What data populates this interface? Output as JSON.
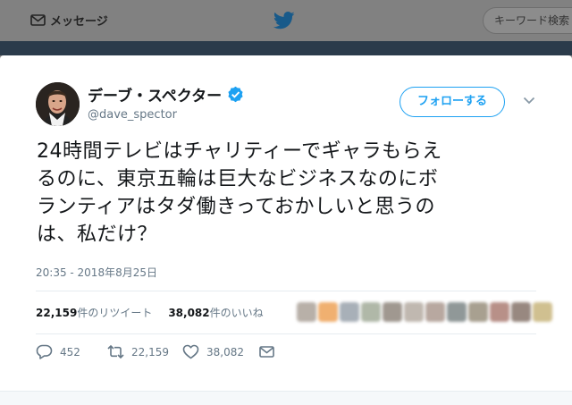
{
  "nav": {
    "messages_label": "メッセージ",
    "search_placeholder": "キーワード検索"
  },
  "tweet": {
    "display_name": "デーブ・スペクター",
    "handle": "@dave_spector",
    "follow_label": "フォローする",
    "text_lines": [
      "24時間テレビはチャリティーでギャラもらえ",
      "るのに、東京五輪は巨大なビジネスなのにボ",
      "ランティアはタダ働きっておかしいと思うの",
      "は、私だけ？"
    ],
    "timestamp": "20:35 - 2018年8月25日",
    "retweet_count": "22,159",
    "retweet_label": "件のリツイート",
    "like_count": "38,082",
    "like_label": "件のいいね",
    "actions": {
      "reply_count": "452",
      "retweet_count": "22,159",
      "like_count": "38,082"
    }
  },
  "colors": {
    "accent": "#1da1f2",
    "text": "#14171a",
    "muted": "#657786",
    "overlay": "#7f7f7f"
  },
  "likers_blurred_colors": [
    "#b8b0a8",
    "#f0b070",
    "#a8b0b8",
    "#b0b8a8",
    "#a09890",
    "#c0b8b0",
    "#b8a8a0",
    "#909898",
    "#a8a090",
    "#b89088",
    "#988880",
    "#d0c090"
  ]
}
